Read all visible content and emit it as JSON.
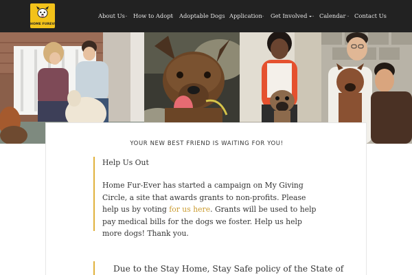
{
  "logo": {
    "text": "HOME FUREVER"
  },
  "nav": {
    "items": [
      {
        "label": "About Us"
      },
      {
        "label": "How to Adopt"
      },
      {
        "label": "Adoptable Dogs"
      },
      {
        "label": "Application"
      },
      {
        "label": "Get Involved"
      },
      {
        "label": "Calendar"
      },
      {
        "label": "Contact Us"
      }
    ]
  },
  "content": {
    "tagline": "YOUR NEW BEST FRIEND IS WAITING FOR YOU!",
    "help": {
      "title": "Help Us Out",
      "body_before": "Home Fur-Ever has started a campaign on My Giving Circle, a site that awards grants to non-profits. Please help us by voting ",
      "link": "for us here",
      "body_after": ". Grants will be used to help pay medical bills for the dogs we foster. Help us help more dogs! Thank you."
    },
    "notice": "Due to the Stay Home, Stay Safe policy of the State of"
  },
  "colors": {
    "header_bg": "#222222",
    "logo_bg": "#f3c21a",
    "accent": "#e0b13b",
    "link": "#c99a2e"
  }
}
